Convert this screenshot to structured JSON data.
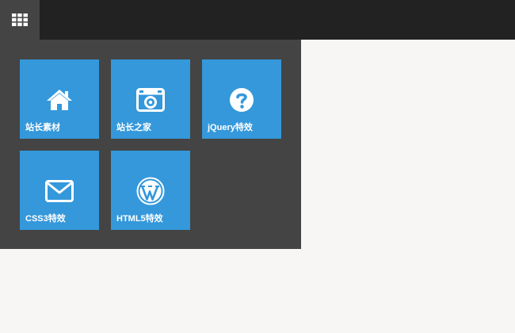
{
  "app": {
    "menu_icon": "grid-icon"
  },
  "colors": {
    "topbar": "#222222",
    "panel": "#444444",
    "tile": "#3498db",
    "background": "#f7f6f4"
  },
  "tiles": [
    {
      "label": "站长素材",
      "icon": "home-icon"
    },
    {
      "label": "站长之家",
      "icon": "camera-icon"
    },
    {
      "label": "jQuery特效",
      "icon": "question-circle-icon"
    },
    {
      "label": "CSS3特效",
      "icon": "envelope-icon"
    },
    {
      "label": "HTML5特效",
      "icon": "wordpress-icon"
    }
  ]
}
